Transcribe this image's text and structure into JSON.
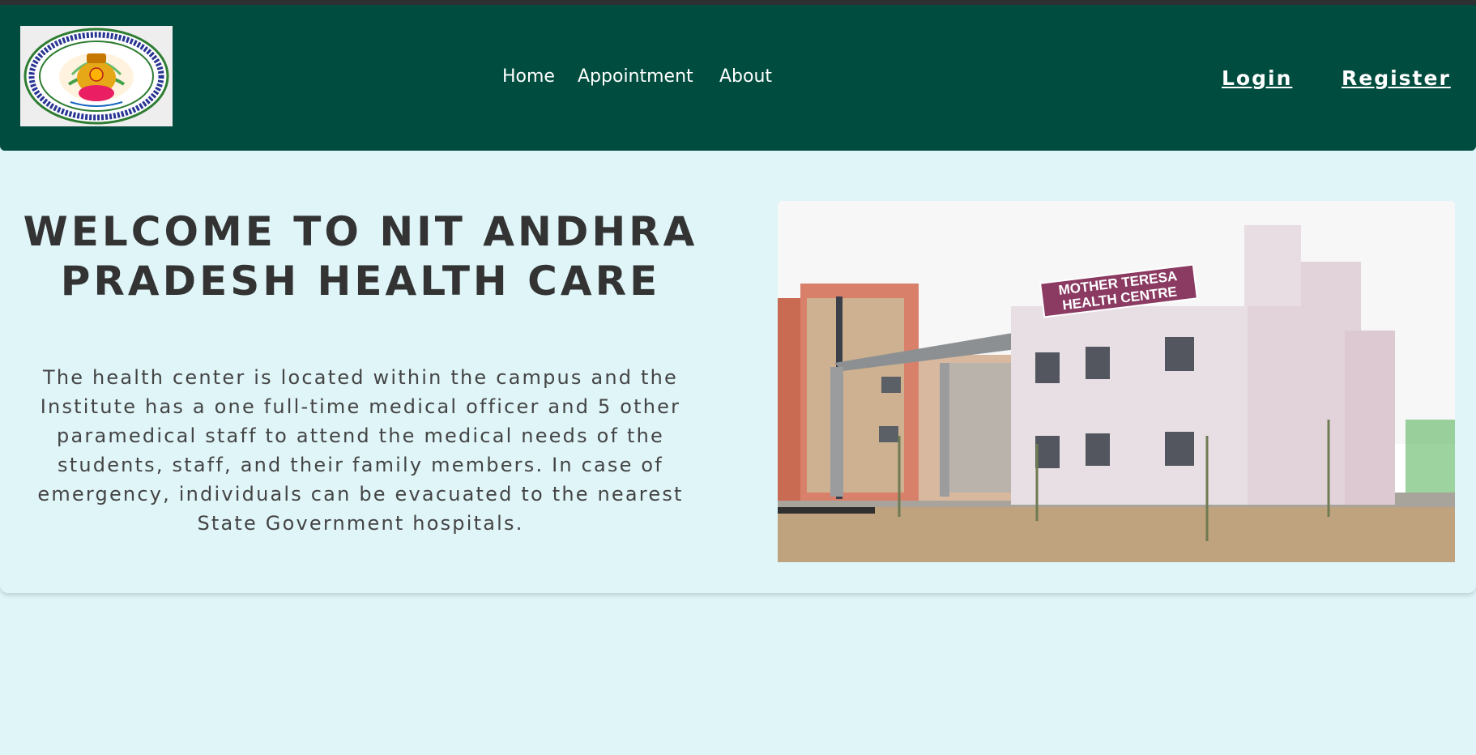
{
  "nav": {
    "links": [
      "Home",
      "Appointment",
      "About"
    ],
    "login": "Login",
    "register": "Register",
    "logo": {
      "name": "nit-andhra-pradesh-seal",
      "ring_text_1": "National Institute of Technology",
      "ring_text_2": "Andhra Pradesh"
    }
  },
  "hero": {
    "title": "WELCOME TO NIT ANDHRA PRADESH HEALTH CARE",
    "description": "The health center is located within the campus and the Institute has a one full-time medical officer and 5 other paramedical staff to attend the medical needs of the students, staff, and their family members. In case of emergency, individuals can be evacuated to the nearest State Government hospitals.",
    "photo_sign_line1": "MOTHER TERESA",
    "photo_sign_line2": "HEALTH CENTRE"
  },
  "colors": {
    "navbar": "#004d40",
    "background": "#dff5f8",
    "text_dark": "#333333",
    "sign_maroon": "#8b3a62"
  }
}
